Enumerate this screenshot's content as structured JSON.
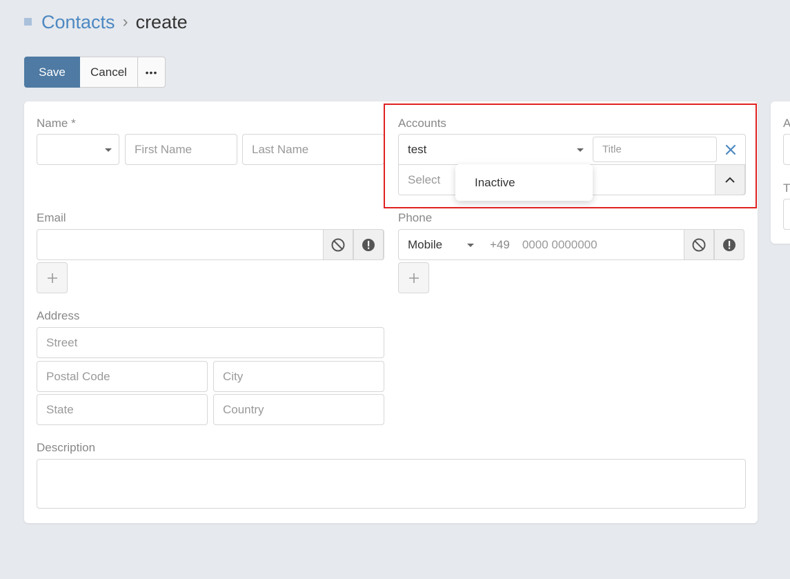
{
  "breadcrumb": {
    "root": "Contacts",
    "separator": "›",
    "current": "create"
  },
  "toolbar": {
    "save_label": "Save",
    "cancel_label": "Cancel",
    "more_label": "•••"
  },
  "form": {
    "name": {
      "label": "Name *",
      "salutation_value": "",
      "first_name_placeholder": "First Name",
      "last_name_placeholder": "Last Name"
    },
    "accounts": {
      "label": "Accounts",
      "account_value": "test",
      "title_placeholder": "Title",
      "select_placeholder": "Select",
      "dropdown_option": "Inactive"
    },
    "email": {
      "label": "Email",
      "value": ""
    },
    "phone": {
      "label": "Phone",
      "type_value": "Mobile",
      "country_code": "+49",
      "number_placeholder": "0000 0000000"
    },
    "address": {
      "label": "Address",
      "street_placeholder": "Street",
      "postal_code_placeholder": "Postal Code",
      "city_placeholder": "City",
      "state_placeholder": "State",
      "country_placeholder": "Country"
    },
    "description": {
      "label": "Description",
      "value": ""
    }
  },
  "side_panel": {
    "label_1": "A",
    "label_2": "T"
  },
  "colors": {
    "primary": "#4e7aa3",
    "link": "#4c88c2",
    "highlight": "#e02020",
    "background": "#e6e9ed"
  },
  "icons": {
    "bullet": "square-bullet-icon",
    "opt_out": "block-icon",
    "invalid": "exclamation-circle-icon",
    "remove": "close-icon",
    "collapse": "chevron-up-icon",
    "add": "plus-icon",
    "dropdown": "caret-down-icon"
  }
}
